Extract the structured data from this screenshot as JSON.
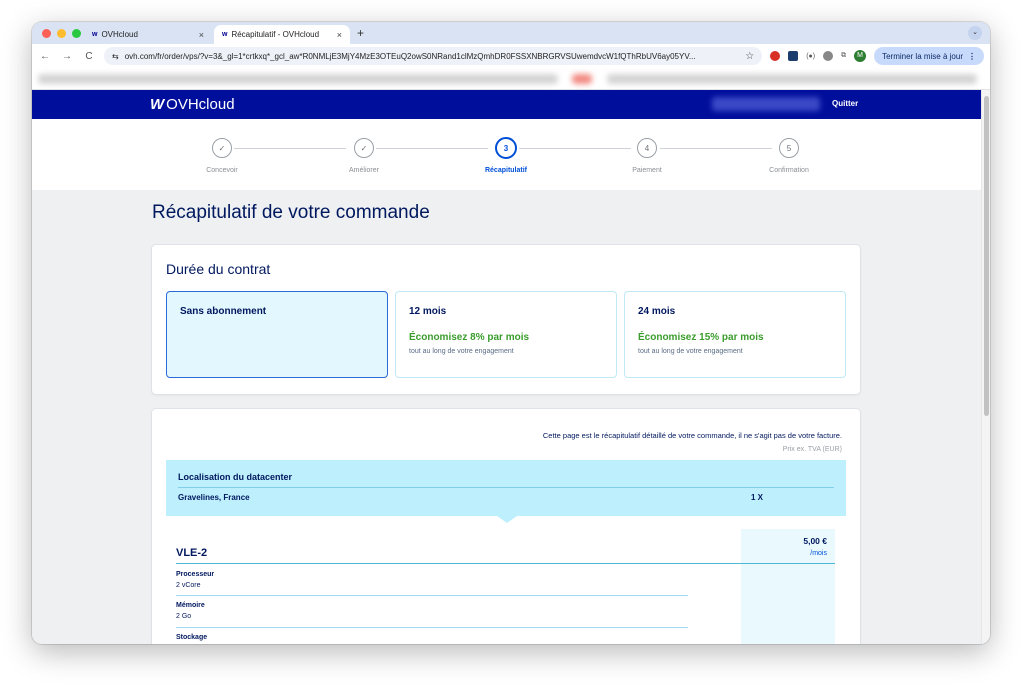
{
  "browser": {
    "tabs": [
      {
        "favicon": "ovh-logo-icon",
        "title": "OVHcloud",
        "close": "×"
      },
      {
        "favicon": "ovh-logo-icon",
        "title": "Récapitulatif - OVHcloud",
        "close": "×"
      }
    ],
    "new_tab": "+",
    "tab_menu": "⌄",
    "url": "ovh.com/fr/order/vps/?v=3&_gl=1*crtkxq*_gcl_aw*R0NMLjE3MjY4MzE3OTEuQ2owS0NRand1clMzQmhDR0FSSXNBRGRVSUwemdvcW1fQThRbUV6ay05YV...",
    "nav_back": "←",
    "nav_forward": "→",
    "nav_reload": "C",
    "site_settings": "⇆",
    "star": "☆",
    "ext_text": "(●)",
    "ext_puzzle": "⧉",
    "avatar_letter": "M",
    "update_button": "Terminer la mise à jour",
    "menu": "⋮"
  },
  "site": {
    "logo_mark": "W",
    "logo_text": "OVHcloud",
    "quit": "Quitter",
    "brand_color": "#000e9c"
  },
  "stepper": {
    "steps": [
      {
        "num": "✓",
        "label": "Concevoir"
      },
      {
        "num": "✓",
        "label": "Améliorer"
      },
      {
        "num": "3",
        "label": "Récapitulatif"
      },
      {
        "num": "4",
        "label": "Paiement"
      },
      {
        "num": "5",
        "label": "Confirmation"
      }
    ],
    "active_index": 2
  },
  "page_title": "Récapitulatif de votre commande",
  "contract": {
    "title": "Durée du contrat",
    "options": [
      {
        "title": "Sans abonnement",
        "save": "",
        "note": "",
        "selected": true
      },
      {
        "title": "12 mois",
        "save": "Économisez 8% par mois",
        "note": "tout au long de votre engagement",
        "selected": false
      },
      {
        "title": "24 mois",
        "save": "Économisez 15% par mois",
        "note": "tout au long de votre engagement",
        "selected": false
      }
    ]
  },
  "summary": {
    "notice": "Cette page est le récapitulatif détaillé de votre commande, il ne s'agit pas de votre facture.",
    "price_label": "Prix ex. TVA (EUR)",
    "datacenter_title": "Localisation du datacenter",
    "datacenter_location": "Gravelines, France",
    "datacenter_qty": "1 X",
    "product_name": "VLE-2",
    "price": "5,00 €",
    "price_period": "/mois",
    "specs": [
      {
        "key": "Processeur",
        "value": "2 vCore"
      },
      {
        "key": "Mémoire",
        "value": "2 Go"
      },
      {
        "key": "Stockage",
        "value": ""
      }
    ]
  }
}
